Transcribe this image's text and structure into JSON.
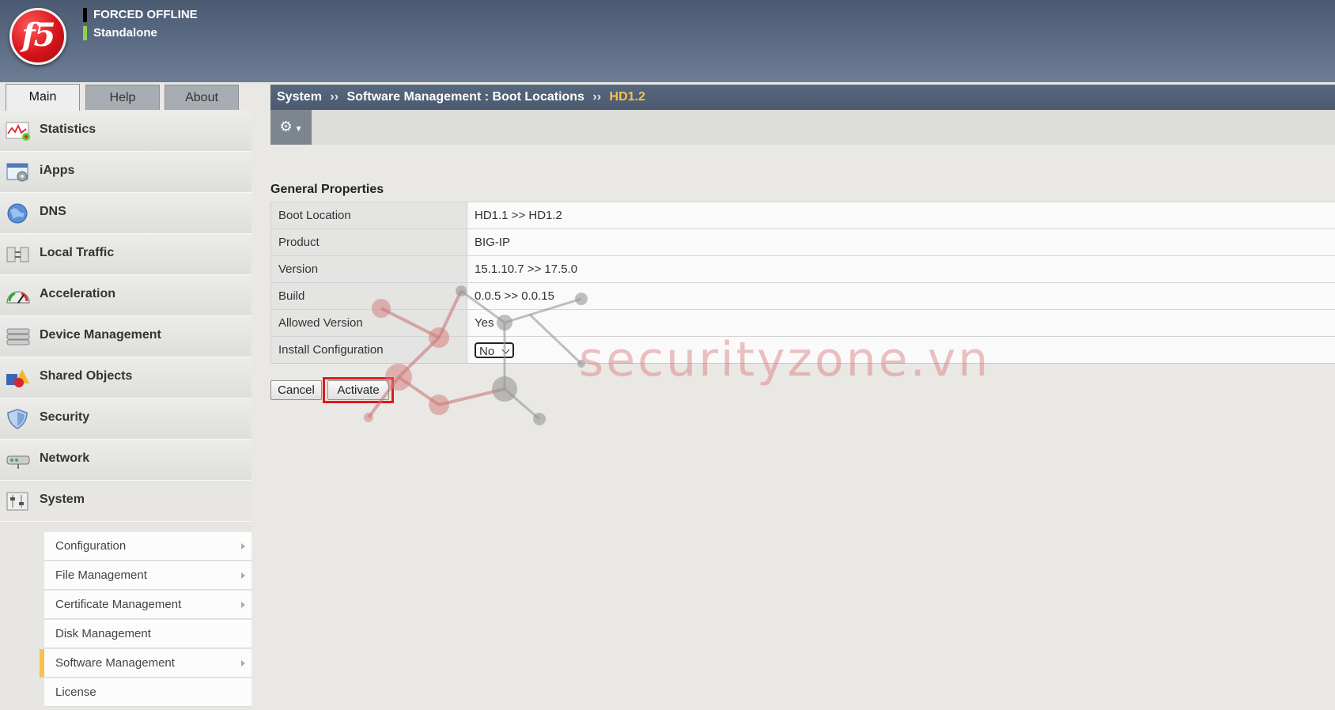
{
  "banner": {
    "status_primary": "FORCED OFFLINE",
    "status_secondary": "Standalone",
    "status_primary_color": "#000000",
    "status_secondary_color": "#8fd14f",
    "logo_text": "f5"
  },
  "tabs": [
    {
      "label": "Main",
      "active": true
    },
    {
      "label": "Help",
      "active": false
    },
    {
      "label": "About",
      "active": false
    }
  ],
  "sidebar": {
    "items": [
      {
        "label": "Statistics",
        "icon": "statistics-icon"
      },
      {
        "label": "iApps",
        "icon": "iapps-icon"
      },
      {
        "label": "DNS",
        "icon": "dns-icon"
      },
      {
        "label": "Local Traffic",
        "icon": "local-traffic-icon"
      },
      {
        "label": "Acceleration",
        "icon": "acceleration-icon"
      },
      {
        "label": "Device Management",
        "icon": "device-management-icon"
      },
      {
        "label": "Shared Objects",
        "icon": "shared-objects-icon"
      },
      {
        "label": "Security",
        "icon": "security-icon"
      },
      {
        "label": "Network",
        "icon": "network-icon"
      },
      {
        "label": "System",
        "icon": "system-icon"
      }
    ],
    "system_submenu": [
      {
        "label": "Configuration",
        "has_arrow": true
      },
      {
        "label": "File Management",
        "has_arrow": true
      },
      {
        "label": "Certificate Management",
        "has_arrow": true
      },
      {
        "label": "Disk Management",
        "has_arrow": false
      },
      {
        "label": "Software Management",
        "has_arrow": true,
        "selected": true
      },
      {
        "label": "License",
        "has_arrow": false
      }
    ]
  },
  "breadcrumb": {
    "items": [
      "System",
      "Software Management : Boot Locations"
    ],
    "separator": "››",
    "current": "HD1.2"
  },
  "toolbar": {
    "gear_icon": "gear-icon"
  },
  "section_title": "General Properties",
  "properties": [
    {
      "key": "Boot Location",
      "value": "HD1.1 >> HD1.2"
    },
    {
      "key": "Product",
      "value": "BIG-IP"
    },
    {
      "key": "Version",
      "value": "15.1.10.7 >> 17.5.0"
    },
    {
      "key": "Build",
      "value": "0.0.5 >> 0.0.15"
    },
    {
      "key": "Allowed Version",
      "value": "Yes"
    },
    {
      "key": "Install Configuration",
      "value": "No"
    }
  ],
  "buttons": {
    "cancel": "Cancel",
    "activate": "Activate"
  },
  "watermark": {
    "text": "securityzone.vn"
  },
  "colors": {
    "accent": "#f6c24a",
    "highlight": "#e01a1a",
    "banner": "#4e5e75"
  }
}
